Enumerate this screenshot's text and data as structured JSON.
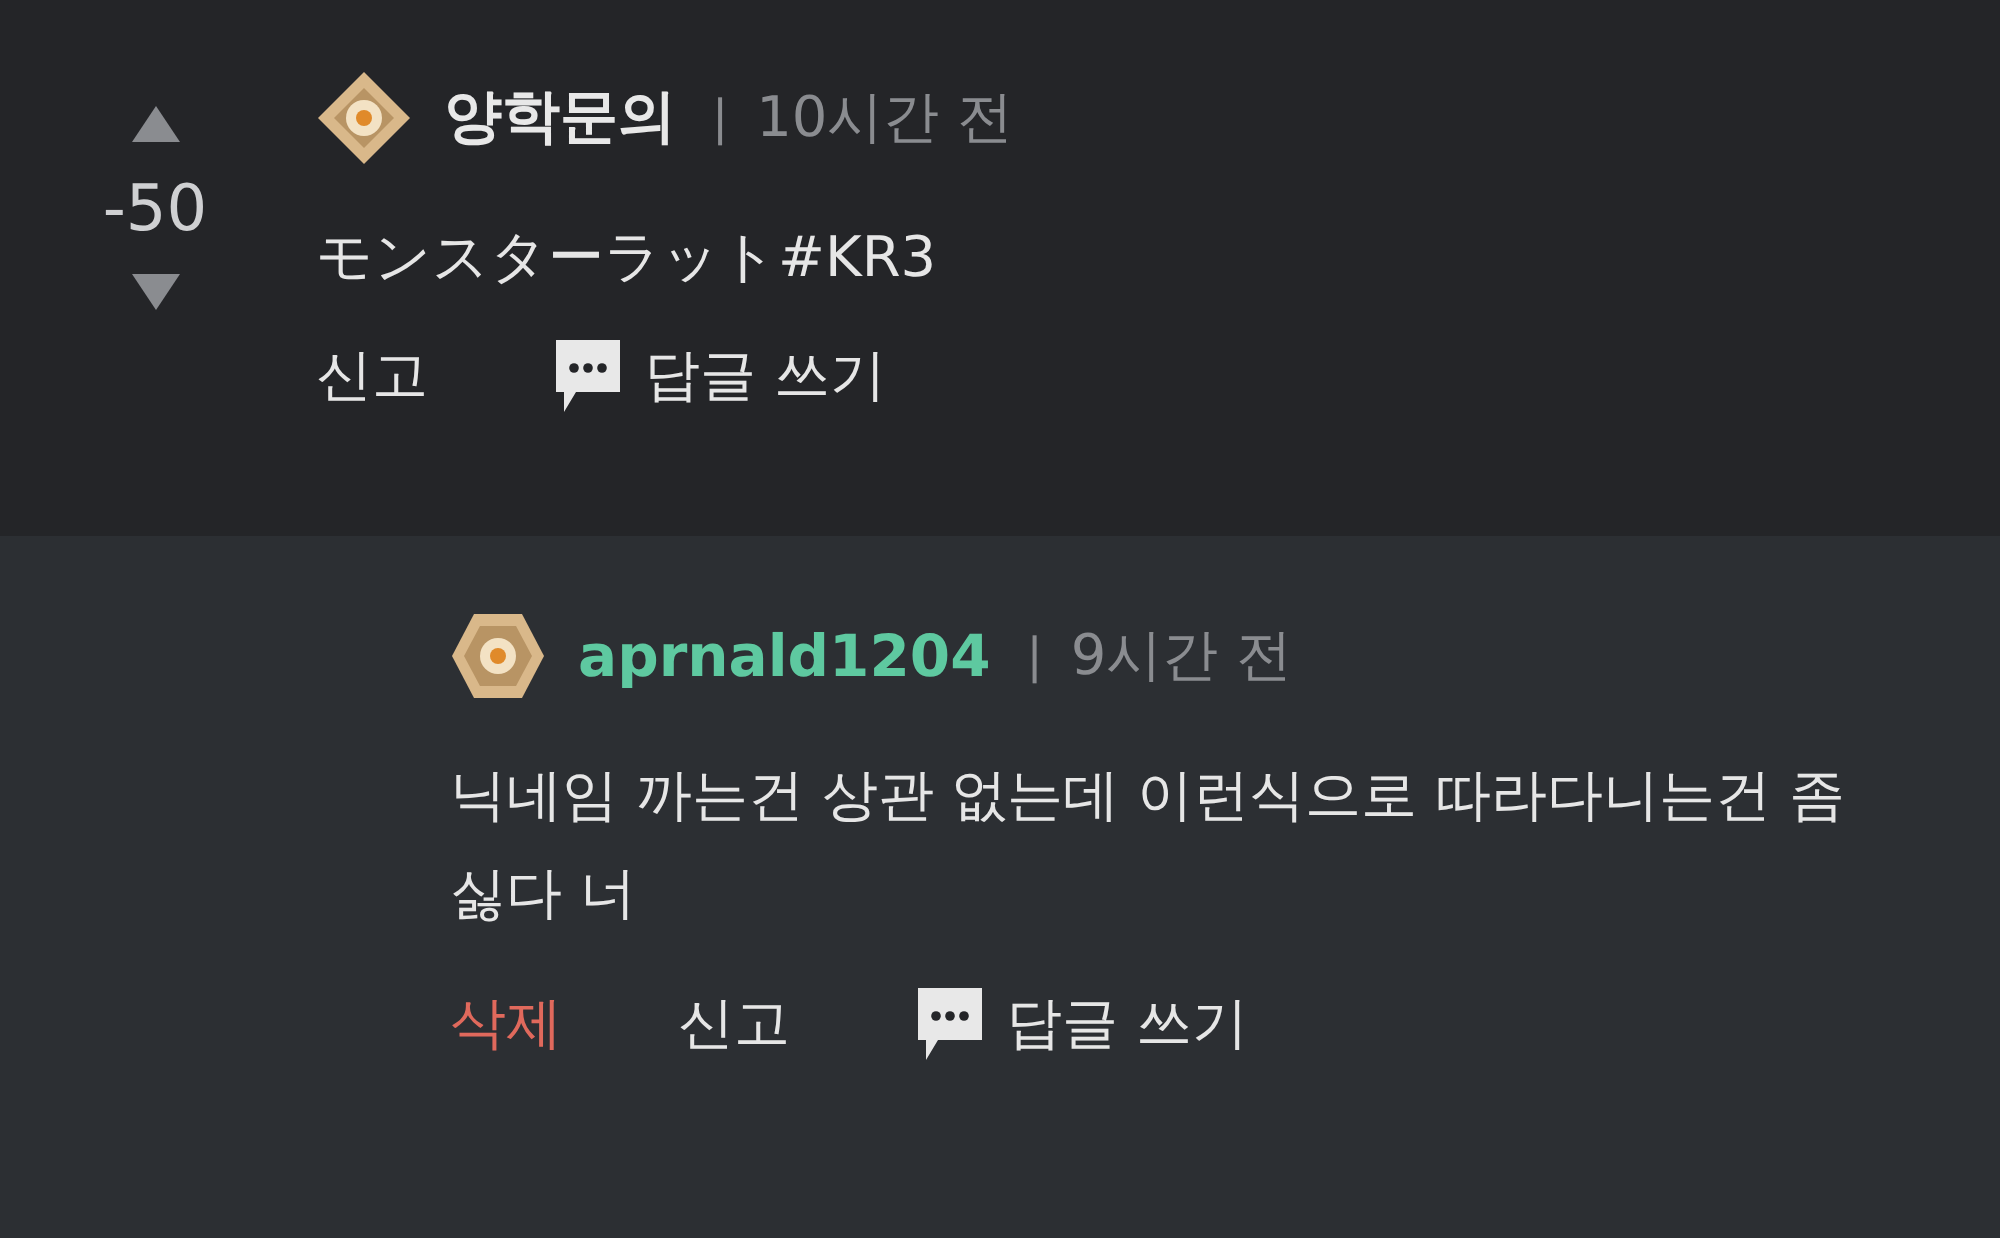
{
  "comment": {
    "vote": {
      "score": "-50"
    },
    "author": {
      "name": "양학문의",
      "badge": {
        "kind": "diamond"
      }
    },
    "separator": "|",
    "time": "10시간 전",
    "body": "モンスターラット#KR3",
    "actions": [
      {
        "kind": "report",
        "label": "신고"
      },
      {
        "kind": "reply",
        "label": "답글 쓰기"
      }
    ]
  },
  "reply": {
    "author": {
      "name": "aprnald1204",
      "badge": {
        "kind": "hexagon"
      }
    },
    "separator": "|",
    "time": "9시간 전",
    "body": "닉네임 까는건 상관 없는데 이런식으로 따라다니는건 좀 싫다 너",
    "actions": [
      {
        "kind": "delete",
        "label": "삭제"
      },
      {
        "kind": "report",
        "label": "신고"
      },
      {
        "kind": "reply",
        "label": "답글 쓰기"
      }
    ]
  }
}
